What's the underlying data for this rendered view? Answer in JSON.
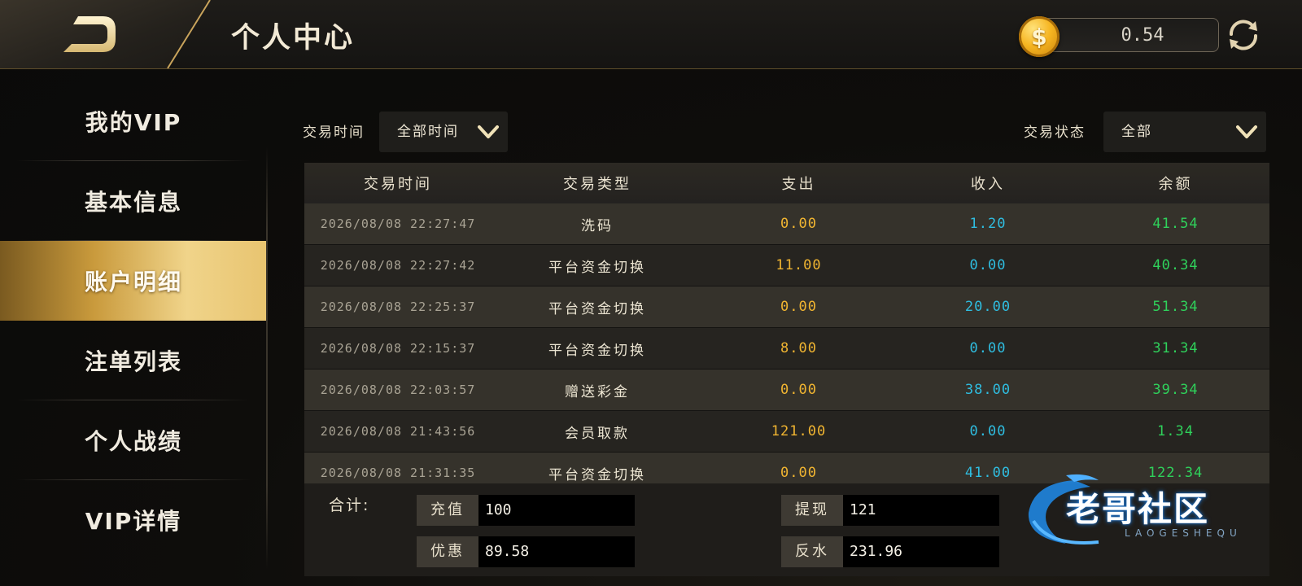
{
  "header": {
    "title": "个人中心",
    "balance": "0.54",
    "coin_symbol": "$"
  },
  "sidebar": {
    "items": [
      {
        "label": "我的VIP",
        "active": false
      },
      {
        "label": "基本信息",
        "active": false
      },
      {
        "label": "账户明细",
        "active": true
      },
      {
        "label": "注单列表",
        "active": false
      },
      {
        "label": "个人战绩",
        "active": false
      },
      {
        "label": "VIP详情",
        "active": false
      }
    ]
  },
  "filters": {
    "time_label": "交易时间",
    "time_value": "全部时间",
    "status_label": "交易状态",
    "status_value": "全部"
  },
  "table": {
    "headers": [
      "交易时间",
      "交易类型",
      "支出",
      "收入",
      "余额"
    ],
    "rows": [
      {
        "time": "2026/08/08 22:27:47",
        "type": "洗码",
        "out": "0.00",
        "in": "1.20",
        "balance": "41.54"
      },
      {
        "time": "2026/08/08 22:27:42",
        "type": "平台资金切换",
        "out": "11.00",
        "in": "0.00",
        "balance": "40.34"
      },
      {
        "time": "2026/08/08 22:25:37",
        "type": "平台资金切换",
        "out": "0.00",
        "in": "20.00",
        "balance": "51.34"
      },
      {
        "time": "2026/08/08 22:15:37",
        "type": "平台资金切换",
        "out": "8.00",
        "in": "0.00",
        "balance": "31.34"
      },
      {
        "time": "2026/08/08 22:03:57",
        "type": "赠送彩金",
        "out": "0.00",
        "in": "38.00",
        "balance": "39.34"
      },
      {
        "time": "2026/08/08 21:43:56",
        "type": "会员取款",
        "out": "121.00",
        "in": "0.00",
        "balance": "1.34"
      },
      {
        "time": "2026/08/08 21:31:35",
        "type": "平台资金切换",
        "out": "0.00",
        "in": "41.00",
        "balance": "122.34"
      }
    ]
  },
  "summary": {
    "label": "合计:",
    "recharge_label": "充值",
    "recharge_value": "100",
    "withdraw_label": "提现",
    "withdraw_value": "121",
    "discount_label": "优惠",
    "discount_value": "89.58",
    "rebate_label": "反水",
    "rebate_value": "231.96"
  },
  "watermark": {
    "text": "老哥社区",
    "sub": "LAOGESHEQU"
  },
  "colors": {
    "accent_gold": "#d8b060",
    "out_color": "#f1b531",
    "in_color": "#2fbde0",
    "balance_color": "#2fd15b"
  }
}
